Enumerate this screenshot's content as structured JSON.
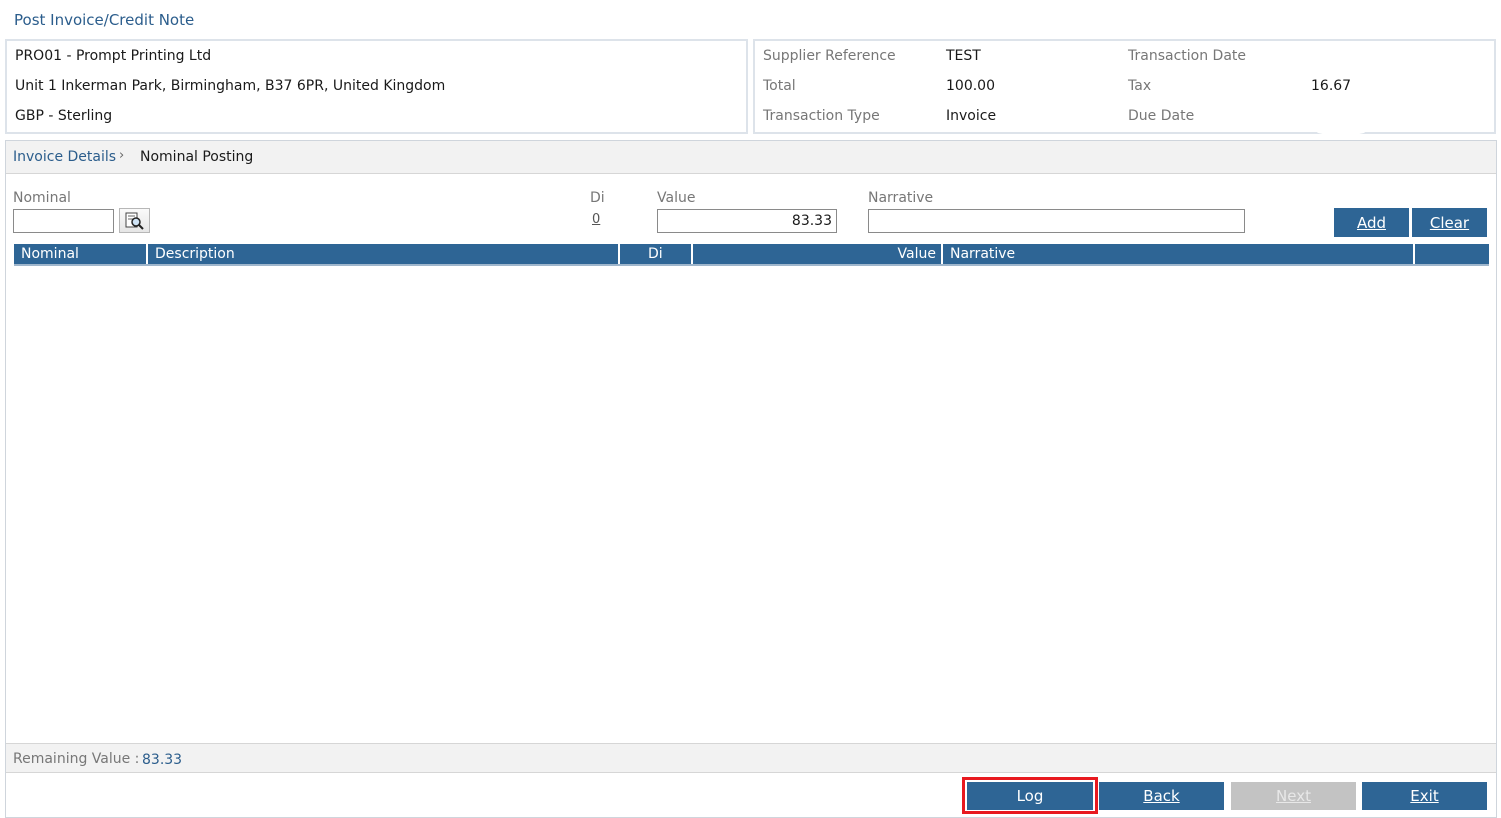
{
  "page": {
    "title": "Post Invoice/Credit Note"
  },
  "supplier": {
    "name": "PRO01 - Prompt Printing Ltd",
    "address": "Unit 1 Inkerman Park, Birmingham, B37 6PR, United Kingdom",
    "currency": "GBP - Sterling"
  },
  "transaction": {
    "supplier_reference_label": "Supplier Reference",
    "supplier_reference_value": "TEST",
    "transaction_date_label": "Transaction Date",
    "transaction_date_value": "",
    "total_label": "Total",
    "total_value": "100.00",
    "tax_label": "Tax",
    "tax_value": "16.67",
    "transaction_type_label": "Transaction Type",
    "transaction_type_value": "Invoice",
    "due_date_label": "Due Date",
    "due_date_value": ""
  },
  "breadcrumb": {
    "link": "Invoice Details",
    "separator": "›",
    "current": "Nominal Posting"
  },
  "entry": {
    "nominal_label": "Nominal",
    "nominal_value": "",
    "lookup_icon": "search-document-icon",
    "di_label": "Di",
    "di_value": "0",
    "value_label": "Value",
    "value_value": "83.33",
    "narrative_label": "Narrative",
    "narrative_value": ""
  },
  "actions": {
    "add": "Add",
    "clear": "Clear"
  },
  "grid": {
    "columns": [
      "Nominal",
      "Description",
      "Di",
      "Value",
      "Narrative",
      ""
    ],
    "rows": []
  },
  "remaining": {
    "label": "Remaining Value :",
    "value": "83.33"
  },
  "footer": {
    "log": "Log",
    "back": "Back",
    "next": "Next",
    "exit": "Exit"
  },
  "colors": {
    "primary": "#2e6595",
    "link": "#2b5d8c",
    "highlight": "#e8191f",
    "disabled": "#c3c3c3"
  }
}
